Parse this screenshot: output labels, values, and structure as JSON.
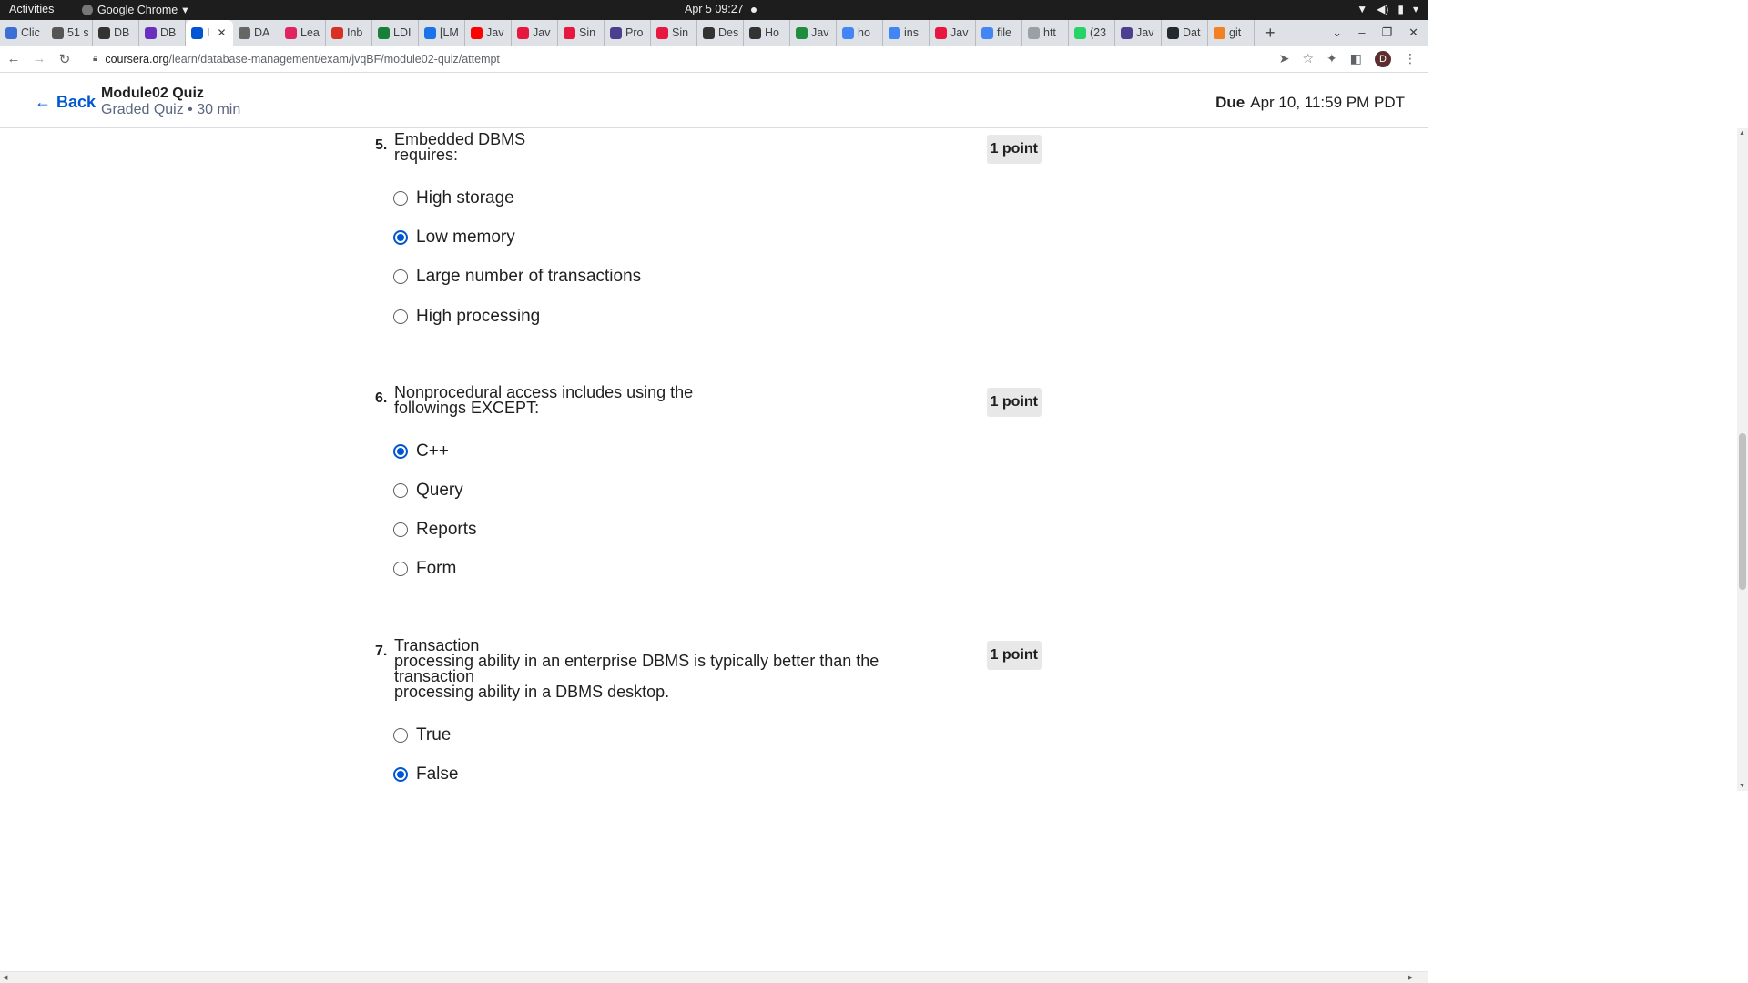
{
  "os": {
    "activities": "Activities",
    "app_name": "Google Chrome",
    "clock": "Apr 5  09:27",
    "tray_icons": [
      "wifi-icon",
      "volume-icon",
      "battery-icon",
      "menu-caret-icon"
    ]
  },
  "browser": {
    "tabs": [
      {
        "label": "Clic",
        "color": "#3b6fd4"
      },
      {
        "label": "51 s",
        "color": "#555555"
      },
      {
        "label": "DB",
        "color": "#333333"
      },
      {
        "label": "DB",
        "color": "#6b2fbf"
      },
      {
        "label": "I",
        "color": "#0056d2",
        "active": true
      },
      {
        "label": "DA",
        "color": "#666666"
      },
      {
        "label": "Lea",
        "color": "#e0245e"
      },
      {
        "label": "Inb",
        "color": "#d93025"
      },
      {
        "label": "LDI",
        "color": "#188038"
      },
      {
        "label": "[LM",
        "color": "#1a73e8"
      },
      {
        "label": "Jav",
        "color": "#ff0000"
      },
      {
        "label": "Jav",
        "color": "#e8173f"
      },
      {
        "label": "Sin",
        "color": "#e8173f"
      },
      {
        "label": "Pro",
        "color": "#4b3f8f"
      },
      {
        "label": "Sin",
        "color": "#e8173f"
      },
      {
        "label": "Des",
        "color": "#333333"
      },
      {
        "label": "Ho",
        "color": "#333333"
      },
      {
        "label": "Jav",
        "color": "#1e8e3e"
      },
      {
        "label": "ho",
        "color": "#4285f4"
      },
      {
        "label": "ins",
        "color": "#4285f4"
      },
      {
        "label": "Jav",
        "color": "#e8173f"
      },
      {
        "label": "file",
        "color": "#4285f4"
      },
      {
        "label": "htt",
        "color": "#9aa0a6"
      },
      {
        "label": "(23",
        "color": "#25d366"
      },
      {
        "label": "Jav",
        "color": "#4b3f8f"
      },
      {
        "label": "Dat",
        "color": "#24292e"
      },
      {
        "label": "git",
        "color": "#f48024"
      }
    ],
    "url_host": "coursera.org",
    "url_path": "/learn/database-management/exam/jvqBF/module02-quiz/attempt",
    "profile_initial": "D"
  },
  "header": {
    "back_label": "Back",
    "title": "Module02 Quiz",
    "subtitle": "Graded Quiz • 30 min",
    "due_label": "Due",
    "due_date": "Apr 10, 11:59 PM PDT"
  },
  "questions": [
    {
      "number": "5.",
      "text": "Embedded DBMS\nrequires:",
      "points": "1 point",
      "options": [
        "High storage",
        "Low memory",
        "Large number of transactions",
        "High processing"
      ],
      "selected": 1
    },
    {
      "number": "6.",
      "text": "Nonprocedural access includes using the\nfollowings EXCEPT:",
      "points": "1 point",
      "options": [
        "C++",
        "Query",
        "Reports",
        "Form"
      ],
      "selected": 0
    },
    {
      "number": "7.",
      "text": "Transaction\nprocessing ability in an enterprise DBMS is typically better than the\ntransaction\nprocessing ability in a DBMS desktop.",
      "points": "1 point",
      "options": [
        "True",
        "False"
      ],
      "selected": 1
    }
  ]
}
